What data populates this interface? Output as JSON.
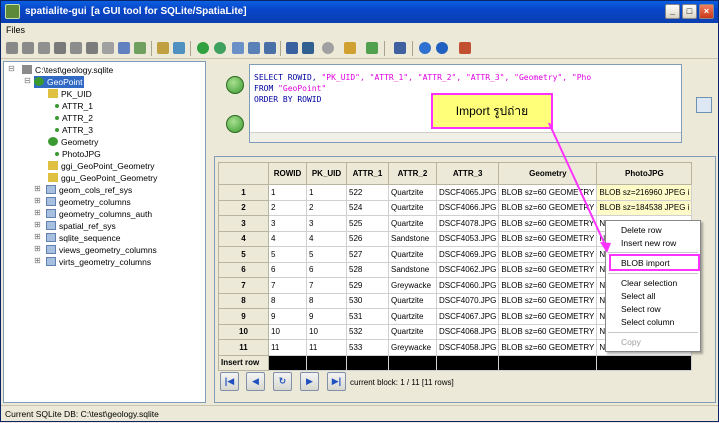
{
  "window": {
    "app_name": "spatialite-gui",
    "subtitle": "[a GUI tool for SQLite/SpatiaLite]"
  },
  "window_buttons": {
    "minimize": "_",
    "maximize": "□",
    "close": "×"
  },
  "menu": {
    "files": "Files"
  },
  "tree": {
    "db_path": "C:\\test\\geology.sqlite",
    "table": "GeoPoint",
    "columns": [
      "PK_UID",
      "ATTR_1",
      "ATTR_2",
      "ATTR_3",
      "Geometry",
      "PhotoJPG"
    ],
    "indexes": [
      "ggi_GeoPoint_Geometry",
      "ggu_GeoPoint_Geometry"
    ],
    "tables": [
      "geom_cols_ref_sys",
      "geometry_columns",
      "geometry_columns_auth",
      "spatial_ref_sys",
      "sqlite_sequence",
      "views_geometry_columns",
      "virts_geometry_columns"
    ]
  },
  "sql": {
    "l1_kw": "SELECT",
    "l1_rest": "ROWID,",
    "l1_strs": "\"PK_UID\", \"ATTR_1\", \"ATTR_2\", \"ATTR_3\", \"Geometry\", \"Pho",
    "l2_kw": "FROM",
    "l2_str": "\"GeoPoint\"",
    "l3_kw": "ORDER BY",
    "l3_rest": "ROWID"
  },
  "grid": {
    "headers": [
      "ROWID",
      "PK_UID",
      "ATTR_1",
      "ATTR_2",
      "ATTR_3",
      "Geometry",
      "PhotoJPG"
    ],
    "rows": [
      [
        "1",
        "1",
        "1",
        "522",
        "Quartzite",
        "DSCF4065.JPG",
        "BLOB sz=60 GEOMETRY",
        "BLOB sz=216960 JPEG i"
      ],
      [
        "2",
        "2",
        "2",
        "524",
        "Quartzite",
        "DSCF4066.JPG",
        "BLOB sz=60 GEOMETRY",
        "BLOB sz=184538 JPEG i"
      ],
      [
        "3",
        "3",
        "3",
        "525",
        "Quartzite",
        "DSCF4078.JPG",
        "BLOB sz=60 GEOMETRY",
        "N"
      ],
      [
        "4",
        "4",
        "4",
        "526",
        "Sandstone",
        "DSCF4053.JPG",
        "BLOB sz=60 GEOMETRY",
        "N"
      ],
      [
        "5",
        "5",
        "5",
        "527",
        "Quartzite",
        "DSCF4069.JPG",
        "BLOB sz=60 GEOMETRY",
        "N"
      ],
      [
        "6",
        "6",
        "6",
        "528",
        "Sandstone",
        "DSCF4062.JPG",
        "BLOB sz=60 GEOMETRY",
        "N"
      ],
      [
        "7",
        "7",
        "7",
        "529",
        "Greywacke",
        "DSCF4060.JPG",
        "BLOB sz=60 GEOMETRY",
        "N"
      ],
      [
        "8",
        "8",
        "8",
        "530",
        "Quartzite",
        "DSCF4070.JPG",
        "BLOB sz=60 GEOMETRY",
        "N"
      ],
      [
        "9",
        "9",
        "9",
        "531",
        "Quartzite",
        "DSCF4067.JPG",
        "BLOB sz=60 GEOMETRY",
        "N"
      ],
      [
        "10",
        "10",
        "10",
        "532",
        "Quartzite",
        "DSCF4068.JPG",
        "BLOB sz=60 GEOMETRY",
        "N"
      ],
      [
        "11",
        "11",
        "11",
        "533",
        "Greywacke",
        "DSCF4058.JPG",
        "BLOB sz=60 GEOMETRY",
        "N"
      ]
    ],
    "insert_row_label": "Insert row"
  },
  "nav": {
    "first": "|◀",
    "prev": "◀",
    "refresh": "↻",
    "next": "▶",
    "last": "▶|",
    "block_label": "current block: 1 / 11 [11 rows]"
  },
  "context_menu": {
    "items": [
      "Delete row",
      "Insert new row",
      "BLOB import",
      "Clear selection",
      "Select all",
      "Select row",
      "Select column",
      "Copy"
    ]
  },
  "annotation": {
    "text": "Import รูปถ่าย"
  },
  "status": {
    "text": "Current SQLite DB: C:\\test\\geology.sqlite"
  },
  "colors": {
    "title_blue": "#0845c8",
    "highlight_magenta": "#ff33ff",
    "callout_yellow": "#ffff7a",
    "sql_keyword": "#0000a0",
    "sql_string": "#e000e0"
  }
}
